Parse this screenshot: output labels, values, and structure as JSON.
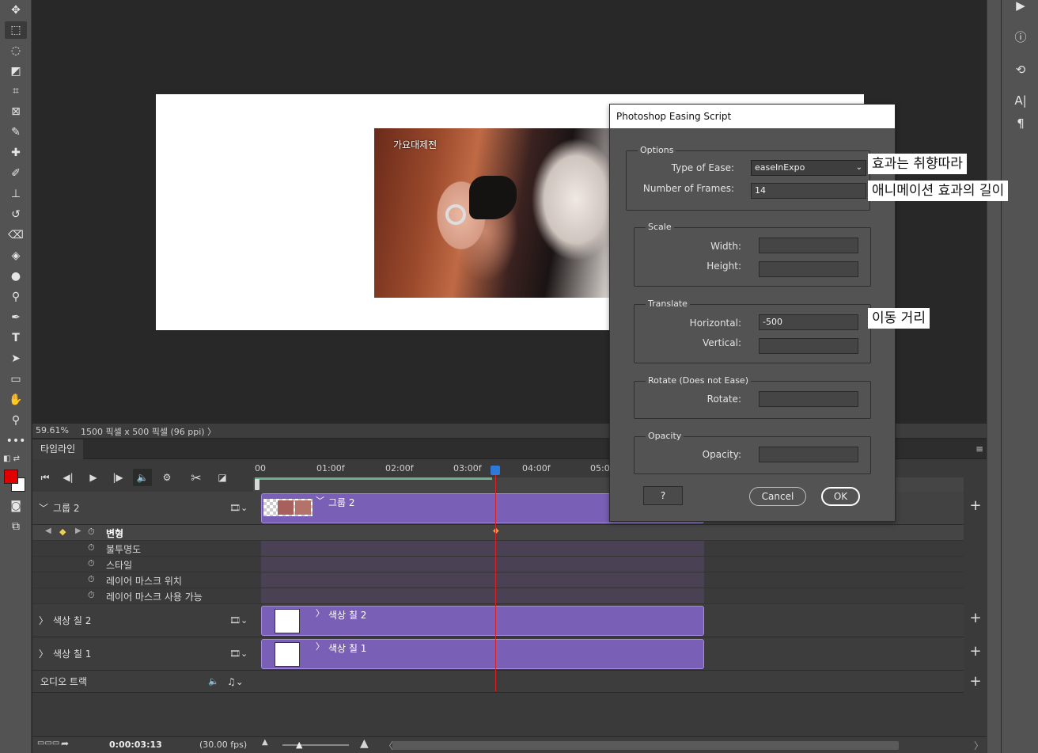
{
  "toolbar": {
    "tools": [
      "move-icon",
      "marquee-icon",
      "lasso-icon",
      "object-select-icon",
      "crop-icon",
      "frame-icon",
      "eyedropper-icon",
      "healing-icon",
      "brush-icon",
      "stamp-icon",
      "history-brush-icon",
      "eraser-icon",
      "bucket-icon",
      "blur-icon",
      "dodge-icon",
      "pen-icon",
      "type-icon",
      "path-select-icon",
      "rectangle-icon",
      "hand-icon",
      "zoom-icon",
      "more-icon"
    ],
    "foreground_color": "#e00000",
    "background_color": "#ffffff"
  },
  "canvas": {
    "image_watermark": "가요대제전"
  },
  "status": {
    "zoom": "59.61%",
    "doc_info": "1500 픽셀 x 500 픽셀 (96 ppi)",
    "arrow": "〉"
  },
  "timeline": {
    "tab_label": "타임라인",
    "ruler_start": "00",
    "ruler_ticks": [
      "01:00f",
      "02:00f",
      "03:00f",
      "04:00f",
      "05:0"
    ],
    "layers": {
      "group2": {
        "name": "그룹 2",
        "clip_label": "그룹 2"
      },
      "props": [
        "변형",
        "불투명도",
        "스타일",
        "레이어 마스크 위치",
        "레이어 마스크 사용 가능"
      ],
      "fill2": {
        "name": "색상 칠 2",
        "clip_label": "색상 칠 2"
      },
      "fill1": {
        "name": "색상 칠 1",
        "clip_label": "색상 칠 1"
      },
      "audio": {
        "name": "오디오 트랙"
      }
    },
    "current_time": "0:00:03:13",
    "fps": "(30.00 fps)"
  },
  "dialog": {
    "title": "Photoshop Easing Script",
    "options": {
      "legend": "Options",
      "type_label": "Type of Ease:",
      "type_value": "easeInExpo",
      "frames_label": "Number of Frames:",
      "frames_value": "14"
    },
    "scale": {
      "legend": "Scale",
      "width_label": "Width:",
      "height_label": "Height:",
      "width_value": "",
      "height_value": ""
    },
    "translate": {
      "legend": "Translate",
      "horizontal_label": "Horizontal:",
      "vertical_label": "Vertical:",
      "horizontal_value": "-500",
      "vertical_value": ""
    },
    "rotate": {
      "legend": "Rotate (Does not Ease)",
      "rotate_label": "Rotate:",
      "rotate_value": ""
    },
    "opacity": {
      "legend": "Opacity",
      "opacity_label": "Opacity:",
      "opacity_value": ""
    },
    "help_label": "?",
    "cancel_label": "Cancel",
    "ok_label": "OK"
  },
  "callouts": {
    "ease": "효과는 취향따라",
    "frames": "애니메이션 효과의 길이",
    "distance": "이동 거리"
  },
  "right_panel": {
    "icons": [
      "play-icon",
      "info-icon",
      "history-icon",
      "character-icon",
      "paragraph-icon"
    ]
  }
}
